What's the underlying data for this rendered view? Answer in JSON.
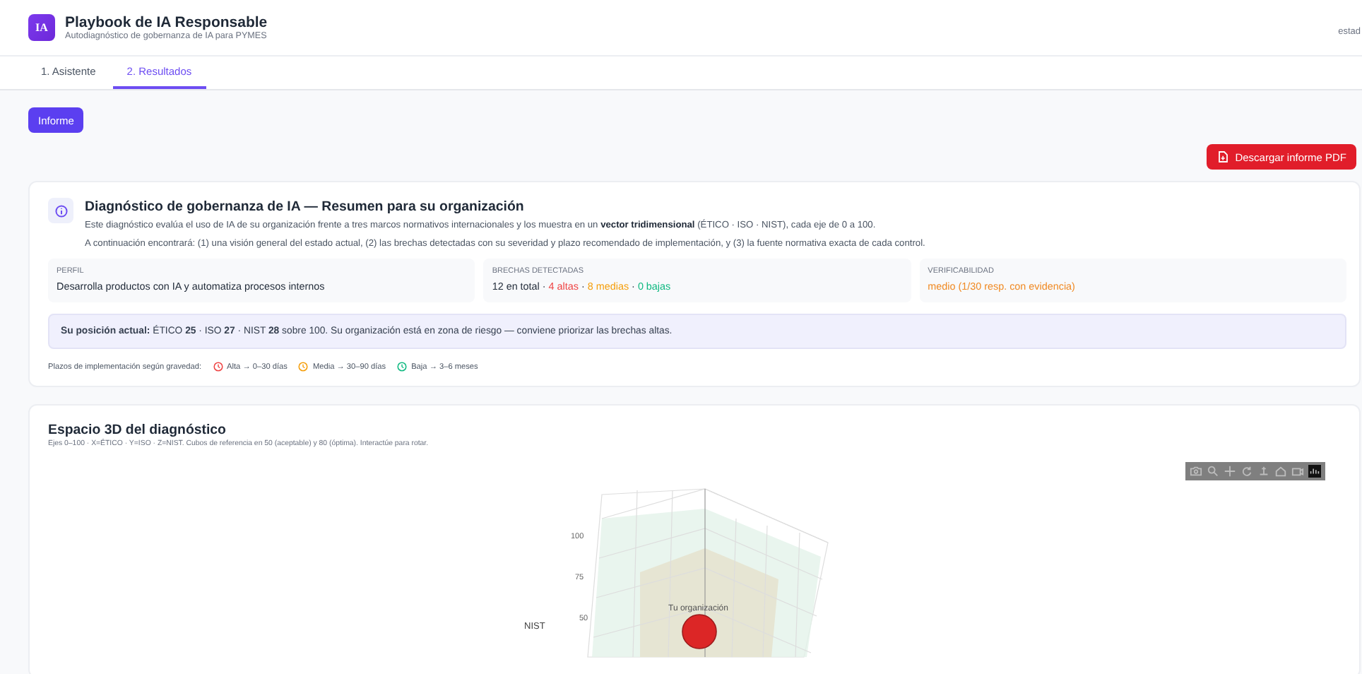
{
  "app": {
    "logo": "IA",
    "title": "Playbook de IA Responsable",
    "subtitle": "Autodiagnóstico de gobernanza de IA para PYMES",
    "status": "estad"
  },
  "tabs": [
    {
      "label": "1. Asistente",
      "selected": false
    },
    {
      "label": "2. Resultados",
      "selected": true
    }
  ],
  "report_button": "Informe",
  "pdf_button": "Descargar informe PDF",
  "summary": {
    "title": "Diagnóstico de gobernanza de IA — Resumen para su organización",
    "lines": [
      "Este diagnóstico evalúa el uso de IA de su organización frente a tres marcos normativos internacionales y los muestra en un **vector tridimensional** (ÉTICO · ISO · NIST), cada eje de 0 a 100.",
      "A continuación encontrará: (1) una visión general del estado actual, (2) las brechas detectadas con su severidad y plazo recomendado de implementación, y (3) la fuente normativa exacta de cada control."
    ],
    "stats": [
      {
        "label": "PERFIL",
        "parts": [
          {
            "text": "Desarrolla productos con IA y automatiza procesos internos"
          }
        ]
      },
      {
        "label": "BRECHAS DETECTADAS",
        "parts": [
          {
            "text": "12 en total · "
          },
          {
            "text": "4 altas",
            "color": "#ef4444"
          },
          {
            "text": " · "
          },
          {
            "text": "8 medias",
            "color": "#f59e0b"
          },
          {
            "text": " · "
          },
          {
            "text": "0 bajas",
            "color": "#10b981"
          }
        ]
      },
      {
        "label": "VERIFICABILIDAD",
        "parts": [
          {
            "text": "medio (1/30 resp. con evidencia)",
            "color": "#f08a24"
          }
        ]
      }
    ],
    "position": "**Su posición actual:** ÉTICO **25** · ISO **27** · NIST **28** sobre 100. Su organización está en zona de riesgo — conviene priorizar las brechas altas.",
    "legend_label": "Plazos de implementación según gravedad:",
    "legend": [
      {
        "text": "Alta → 0–30 días",
        "color": "#ef4444"
      },
      {
        "text": "Media → 30–90 días",
        "color": "#f59e0b"
      },
      {
        "text": "Baja → 3–6 meses",
        "color": "#10b981"
      }
    ]
  },
  "plot": {
    "title": "Espacio 3D del diagnóstico",
    "subtitle": "Ejes 0–100 · X=ÉTICO · Y=ISO · Z=NIST. Cubos de referencia en 50 (aceptable) y 80 (óptima). Interactúe para rotar.",
    "axis_label": "NIST",
    "ticks": [
      "100",
      "75",
      "50"
    ],
    "point_label": "Tu organización"
  }
}
